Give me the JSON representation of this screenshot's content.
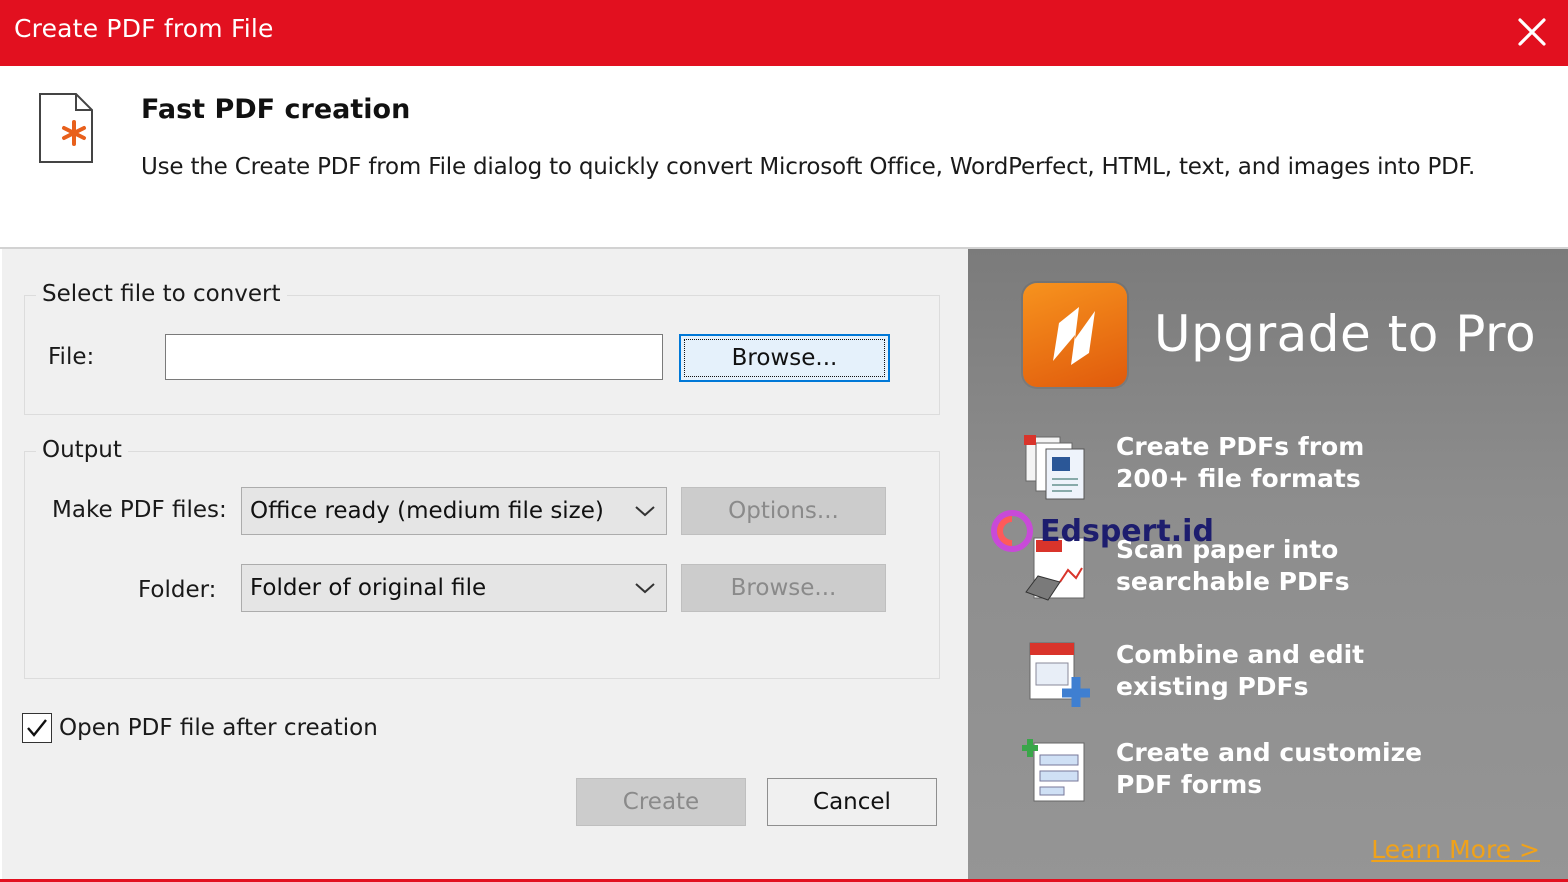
{
  "window": {
    "title": "Create PDF from File",
    "close_icon": "close-icon",
    "accent_color": "#e2101f"
  },
  "header": {
    "heading": "Fast PDF creation",
    "description": "Use the Create PDF from File dialog to quickly convert Microsoft Office, WordPerfect, HTML, text, and images into PDF.",
    "icon": "document-star-icon"
  },
  "select_file": {
    "legend": "Select file to convert",
    "file_label": "File:",
    "file_value": "",
    "browse_label": "Browse..."
  },
  "output": {
    "legend": "Output",
    "make_pdf_label": "Make PDF files:",
    "make_pdf_value": "Office ready (medium file size)",
    "options_label": "Options...",
    "folder_label": "Folder:",
    "folder_value": "Folder of original file",
    "folder_browse_label": "Browse..."
  },
  "open_after": {
    "label": "Open PDF file after creation",
    "checked": true
  },
  "actions": {
    "create_label": "Create",
    "cancel_label": "Cancel"
  },
  "promo": {
    "title": "Upgrade to Pro",
    "logo_icon": "nitro-logo-icon",
    "features": [
      {
        "line1": "Create PDFs from",
        "line2": "200+ file formats",
        "icon": "file-formats-icon"
      },
      {
        "line1": "Scan paper into",
        "line2": "searchable PDFs",
        "icon": "scanner-icon"
      },
      {
        "line1": "Combine and edit",
        "line2": "existing PDFs",
        "icon": "combine-icon"
      },
      {
        "line1": "Create and customize",
        "line2": "PDF forms",
        "icon": "form-icon"
      }
    ],
    "learn_more": "Learn More >",
    "learn_color": "#f0a21a"
  },
  "watermark": {
    "text": "Edspert.id"
  }
}
